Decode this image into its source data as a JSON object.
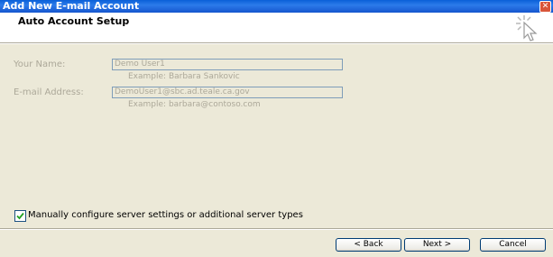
{
  "window": {
    "title": "Add New E-mail Account",
    "close_glyph": "✕"
  },
  "header": {
    "title": "Auto Account Setup",
    "icon": "wizard-cursor-icon"
  },
  "form": {
    "name": {
      "label": "Your Name:",
      "value": "Demo User1",
      "example": "Example: Barbara Sankovic"
    },
    "email": {
      "label": "E-mail Address:",
      "value": "DemoUser1@sbc.ad.teale.ca.gov",
      "example": "Example: barbara@contoso.com"
    }
  },
  "manual_config": {
    "checked": true,
    "label": "Manually configure server settings or additional server types"
  },
  "buttons": {
    "back": "< Back",
    "next": "Next >",
    "cancel": "Cancel"
  },
  "colors": {
    "titlebar": "#0A5FD8",
    "dialog_bg": "#ECE9D8",
    "disabled_text": "#ACA899"
  }
}
